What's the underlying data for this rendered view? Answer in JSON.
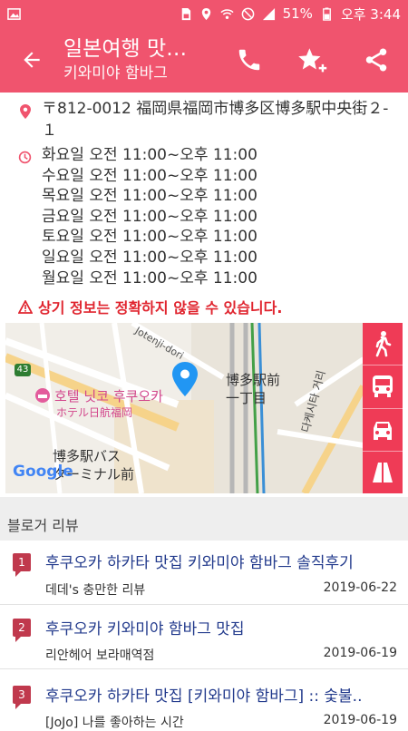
{
  "status_bar": {
    "battery": "51%",
    "time": "오후 3:44"
  },
  "app_bar": {
    "title": "일본여행 맛…",
    "subtitle": "키와미야 함바그",
    "icons": [
      "back-arrow-icon",
      "phone-icon",
      "star-add-icon",
      "share-icon"
    ]
  },
  "info": {
    "address": "〒812-0012 福岡県福岡市博多区博多駅中央街２-１",
    "hours": [
      "화요일 오전 11:00~오후 11:00",
      "수요일 오전 11:00~오후 11:00",
      "목요일 오전 11:00~오후 11:00",
      "금요일 오전 11:00~오후 11:00",
      "토요일 오전 11:00~오후 11:00",
      "일요일 오전 11:00~오후 11:00",
      "월요일 오전 11:00~오후 11:00"
    ],
    "warning": "상기 정보는 정확하지 않을 수 있습니다."
  },
  "map": {
    "labels": {
      "road": "Jotenji-dori",
      "route_num": "43",
      "hotel_kr": "호텔 닛코 후쿠오카",
      "hotel_jp": "ホテル日航福岡",
      "station_area": "博多駅前",
      "station_area2": "一丁目",
      "bus_terminal1": "博多駅バス",
      "bus_terminal2": "ターミナル前",
      "street": "다케시타 거리",
      "logo": "Google"
    },
    "modes": [
      "walk-icon",
      "bus-icon",
      "car-icon",
      "road-icon"
    ]
  },
  "blog": {
    "header": "블로거 리뷰",
    "reviews": [
      {
        "num": "1",
        "title": "후쿠오카 하카타 맛집 키와미야 함바그 솔직후기",
        "author": "데데's 충만한 리뷰",
        "date": "2019-06-22"
      },
      {
        "num": "2",
        "title": "후쿠오카 키와미야 함바그 맛집",
        "author": "리안헤어 보라매역점",
        "date": "2019-06-19"
      },
      {
        "num": "3",
        "title": "후쿠오카 하카타 맛집 [키와미야 함바그] :: 숯불..",
        "author": "[JoJo] 나를 좋아하는 시간",
        "date": "2019-06-19"
      }
    ]
  },
  "colors": {
    "primary": "#f0546e",
    "map_side": "#ef3b56",
    "warning": "#e0252f",
    "link": "#223a8c"
  }
}
